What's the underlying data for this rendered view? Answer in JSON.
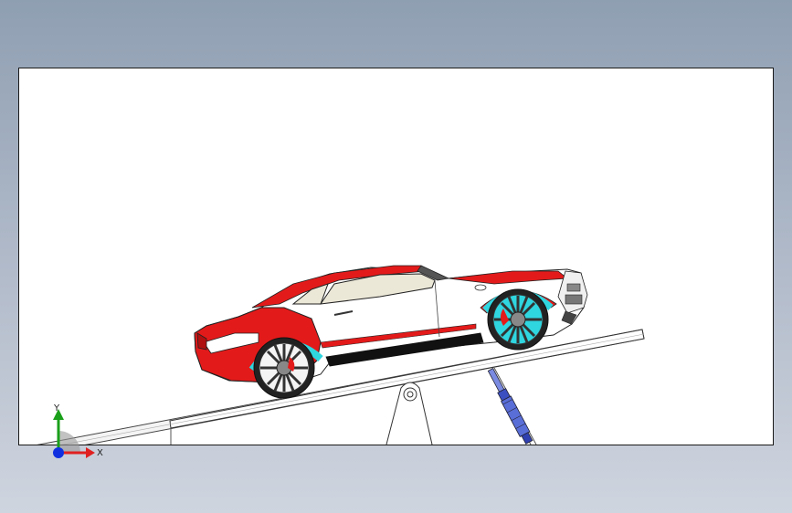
{
  "viewport": {
    "name": "graphics-area",
    "model": "car-on-tilting-ramp-assembly"
  },
  "triad": {
    "x_label": "X",
    "y_label": "Y",
    "colors": {
      "x": "#e02020",
      "y": "#1aa01a",
      "z": "#1030e0"
    }
  },
  "colors": {
    "body_red": "#e31a1a",
    "wheel_cyan": "#2fd6e0",
    "ramp_gray": "#9a9a9a",
    "actuator_blue": "#4a5fd0",
    "background_top": "#8f9fb2",
    "background_bottom": "#cfd5df"
  }
}
